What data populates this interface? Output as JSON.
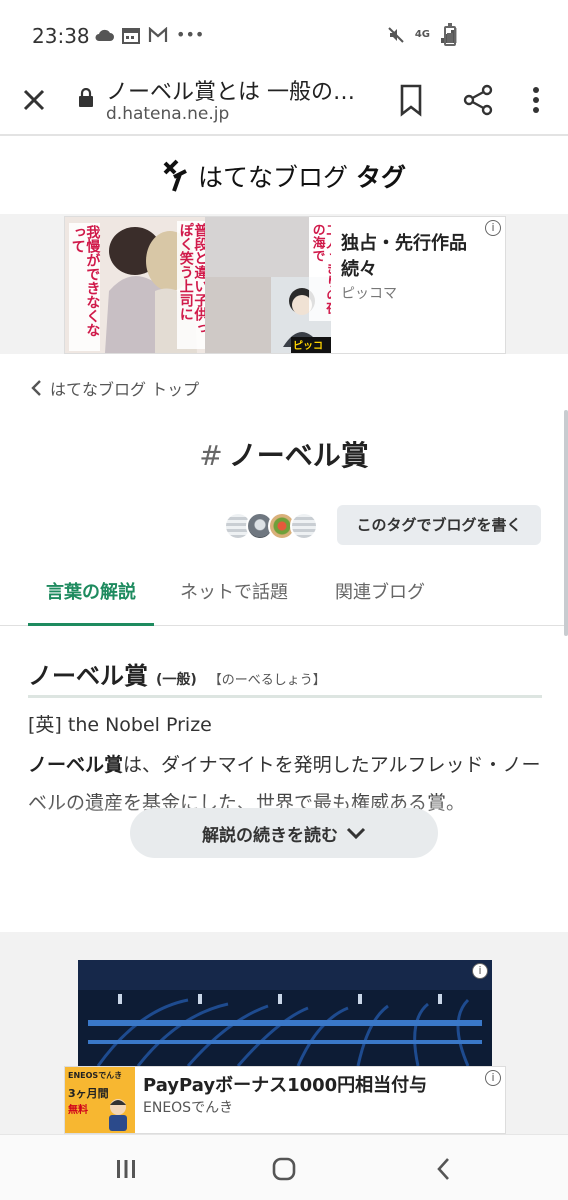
{
  "status_bar": {
    "time": "23:38",
    "icons_left": [
      "cloud-icon",
      "calendar-icon",
      "gmail-icon",
      "more-notifications-icon"
    ],
    "icons_right": [
      "mute-icon",
      "4g-icon",
      "signal-icon",
      "battery-icon"
    ],
    "network": "4G"
  },
  "browser": {
    "page_title": "ノーベル賞とは 一般の…",
    "domain": "d.hatena.ne.jp"
  },
  "site_header": {
    "logo_text": "はてなブログ",
    "logo_strong": "タグ"
  },
  "ad_top": {
    "title": "独占・先行作品続々",
    "advertiser": "ピッコマ",
    "manga_text_1": "我慢ができなくなって",
    "manga_text_2": "普段と違い子供っぽく笑う上司に",
    "manga_text_3": "二人っきりの夜の海で",
    "manga_brand": "ピッコマ"
  },
  "breadcrumb": {
    "label": "はてなブログ トップ"
  },
  "tag": {
    "hash": "#",
    "name": "ノーベル賞",
    "write_button": "このタグでブログを書く"
  },
  "tabs": [
    {
      "label": "言葉の解説",
      "active": true
    },
    {
      "label": "ネットで話題",
      "active": false
    },
    {
      "label": "関連ブログ",
      "active": false
    }
  ],
  "term": {
    "name": "ノーベル賞",
    "category": "(一般)",
    "reading": "【のーべるしょう】",
    "english": "[英] the Nobel Prize",
    "desc_bold": "ノーベル賞",
    "desc_rest": "は、ダイナマイトを発明したアルフレッド・ノーベルの遺産を基金にした、世界で最も権威ある賞。",
    "read_more": "解説の続きを読む"
  },
  "ad_bottom": {
    "title": "PayPayボーナス1000円相当付与",
    "advertiser": "ENEOSでんき",
    "thumb_line1": "ENEOSでんき",
    "thumb_line2": "3ヶ月間",
    "thumb_line3": "無料"
  },
  "colors": {
    "accent": "#1e8b5f",
    "text": "#222222",
    "button_bg": "#e9ecef"
  }
}
